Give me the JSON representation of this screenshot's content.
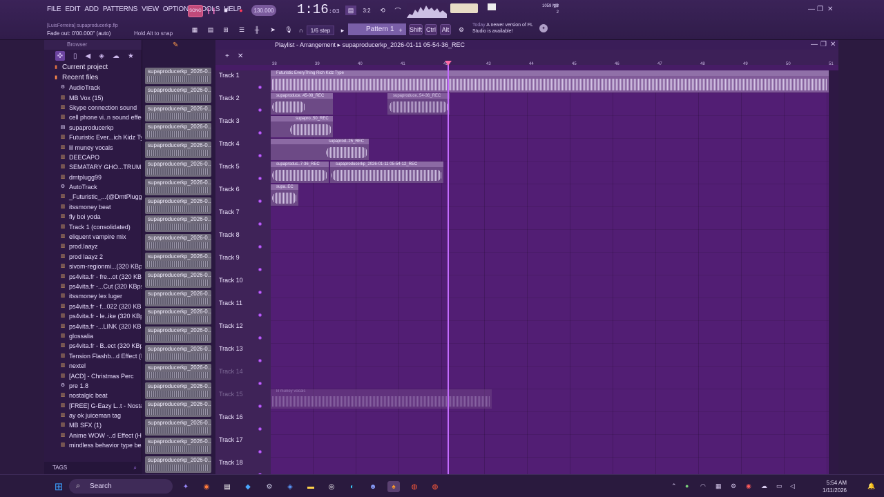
{
  "menu": [
    "FILE",
    "EDIT",
    "ADD",
    "PATTERNS",
    "VIEW",
    "OPTIONS",
    "TOOLS",
    "HELP"
  ],
  "toolbar": {
    "song_mode": "SONG",
    "tempo": "130.000",
    "time": "1:16",
    "time_small": ":03",
    "time_sig": "3:2",
    "step": "1/6 step",
    "pattern": "Pattern 1",
    "mem_a": "17",
    "mem_b": "1059 MB",
    "mem_c": "2",
    "modifiers": [
      "Shift",
      "Ctrl",
      "Alt"
    ],
    "news_date": "Today",
    "news_text": "A newer version of FL Studio is available!"
  },
  "hints": {
    "project_line": "[LuisFerreira] supaproducerkp.flp",
    "fade": "Fade out: 0'00.000\" (auto)",
    "snap": "Hold Alt to snap"
  },
  "browser": {
    "title": "Browser",
    "folders": [
      "Current project",
      "Recent files"
    ],
    "items": [
      {
        "icon": "automation-icon",
        "label": "AudioTrack"
      },
      {
        "icon": "audio-file-icon",
        "label": "MB Vox (15)"
      },
      {
        "icon": "audio-file-icon",
        "label": "Skype connection sound"
      },
      {
        "icon": "audio-file-icon",
        "label": "cell phone vi..n sound effect"
      },
      {
        "icon": "project-icon",
        "label": "supaproducerkp"
      },
      {
        "icon": "audio-file-icon",
        "label": "Futuristic Ever...ich Kidz Type"
      },
      {
        "icon": "audio-file-icon",
        "label": "lil muney vocals"
      },
      {
        "icon": "audio-file-icon",
        "label": "DEECAPO"
      },
      {
        "icon": "audio-file-icon",
        "label": "SEMATARY GHO...TRUMENTAL"
      },
      {
        "icon": "audio-file-icon",
        "label": "dmtplugg99"
      },
      {
        "icon": "automation-icon",
        "label": "AutoTrack"
      },
      {
        "icon": "audio-file-icon",
        "label": "_Futuristic_...(@DmtPlugg99)"
      },
      {
        "icon": "audio-file-icon",
        "label": "itssmoney beat"
      },
      {
        "icon": "audio-file-icon",
        "label": "fly boi yoda"
      },
      {
        "icon": "audio-file-icon",
        "label": "Track 1 (consolidated)"
      },
      {
        "icon": "audio-file-icon",
        "label": "eliquent vampire mix"
      },
      {
        "icon": "audio-file-icon",
        "label": "prod.laayz"
      },
      {
        "icon": "audio-file-icon",
        "label": "prod laayz 2"
      },
      {
        "icon": "audio-file-icon",
        "label": "sivom-regionmi...(320 KBps)"
      },
      {
        "icon": "audio-file-icon",
        "label": "ps4vita.fr - fre...ot (320 KBps)"
      },
      {
        "icon": "audio-file-icon",
        "label": "ps4vita.fr -...Cut (320 KBps)"
      },
      {
        "icon": "audio-file-icon",
        "label": "itssmoney lex luger"
      },
      {
        "icon": "audio-file-icon",
        "label": "ps4vita.fr - f...022 (320 KBps)"
      },
      {
        "icon": "audio-file-icon",
        "label": "ps4vita.fr - le..ike (320 KBps)"
      },
      {
        "icon": "audio-file-icon",
        "label": "ps4vita.fr -...LINK (320 KBps)"
      },
      {
        "icon": "audio-file-icon",
        "label": "glossalia"
      },
      {
        "icon": "audio-file-icon",
        "label": "ps4vita.fr - B..ect (320 KBps)"
      },
      {
        "icon": "audio-file-icon",
        "label": "Tension Flashb...d Effect (HD)"
      },
      {
        "icon": "audio-file-icon",
        "label": "nextel"
      },
      {
        "icon": "audio-file-icon",
        "label": "[ACD] - Christmas Perc"
      },
      {
        "icon": "automation-icon",
        "label": "pre 1.8"
      },
      {
        "icon": "audio-file-icon",
        "label": "nostalgic beat"
      },
      {
        "icon": "audio-file-icon",
        "label": "[FREE] G-Eazy L..t - Nostalgic"
      },
      {
        "icon": "audio-file-icon",
        "label": "ay ok juiceman tag"
      },
      {
        "icon": "audio-file-icon",
        "label": "MB SFX (1)"
      },
      {
        "icon": "audio-file-icon",
        "label": "Anime WOW -..d Effect (HD)"
      },
      {
        "icon": "audio-file-icon",
        "label": "mindless behavior type beat"
      }
    ],
    "tags_label": "TAGS"
  },
  "clip_list": {
    "label": "supaproducerkp_2026-0...",
    "count": 22
  },
  "playlist": {
    "title": "Playlist - Arrangement",
    "breadcrumb": "supaproducerkp_2026-01-11 05-54-36_REC",
    "ruler": [
      "38",
      "39",
      "40",
      "41",
      "42",
      "43",
      "44",
      "45",
      "46",
      "47",
      "48",
      "49",
      "50",
      "51"
    ],
    "tracks": [
      "Track 1",
      "Track 2",
      "Track 3",
      "Track 4",
      "Track 5",
      "Track 6",
      "Track 7",
      "Track 8",
      "Track 9",
      "Track 10",
      "Track 11",
      "Track 12",
      "Track 13",
      "Track 14",
      "Track 15",
      "Track 16",
      "Track 17",
      "Track 18"
    ],
    "clips": [
      {
        "track": 1,
        "label": "Futuristic EveryThing Rich Kidz Type"
      },
      {
        "track": 2,
        "label": "supaproduce..45-08_REC"
      },
      {
        "track": 2,
        "label": "supaproduce..54-36_REC"
      },
      {
        "track": 3,
        "label": "supapro..50_REC"
      },
      {
        "track": 4,
        "label": "supaprod..25_REC"
      },
      {
        "track": 5,
        "label": "supaproduc..7-36_REC"
      },
      {
        "track": 5,
        "label": "supaproducerkp_2026-01-11 05-54-12_REC"
      },
      {
        "track": 6,
        "label": "supa..EC"
      },
      {
        "track": 15,
        "label": "lil muney vocals"
      }
    ]
  },
  "taskbar": {
    "search": "Search",
    "time": "5:54 AM",
    "date": "1/11/2026"
  }
}
